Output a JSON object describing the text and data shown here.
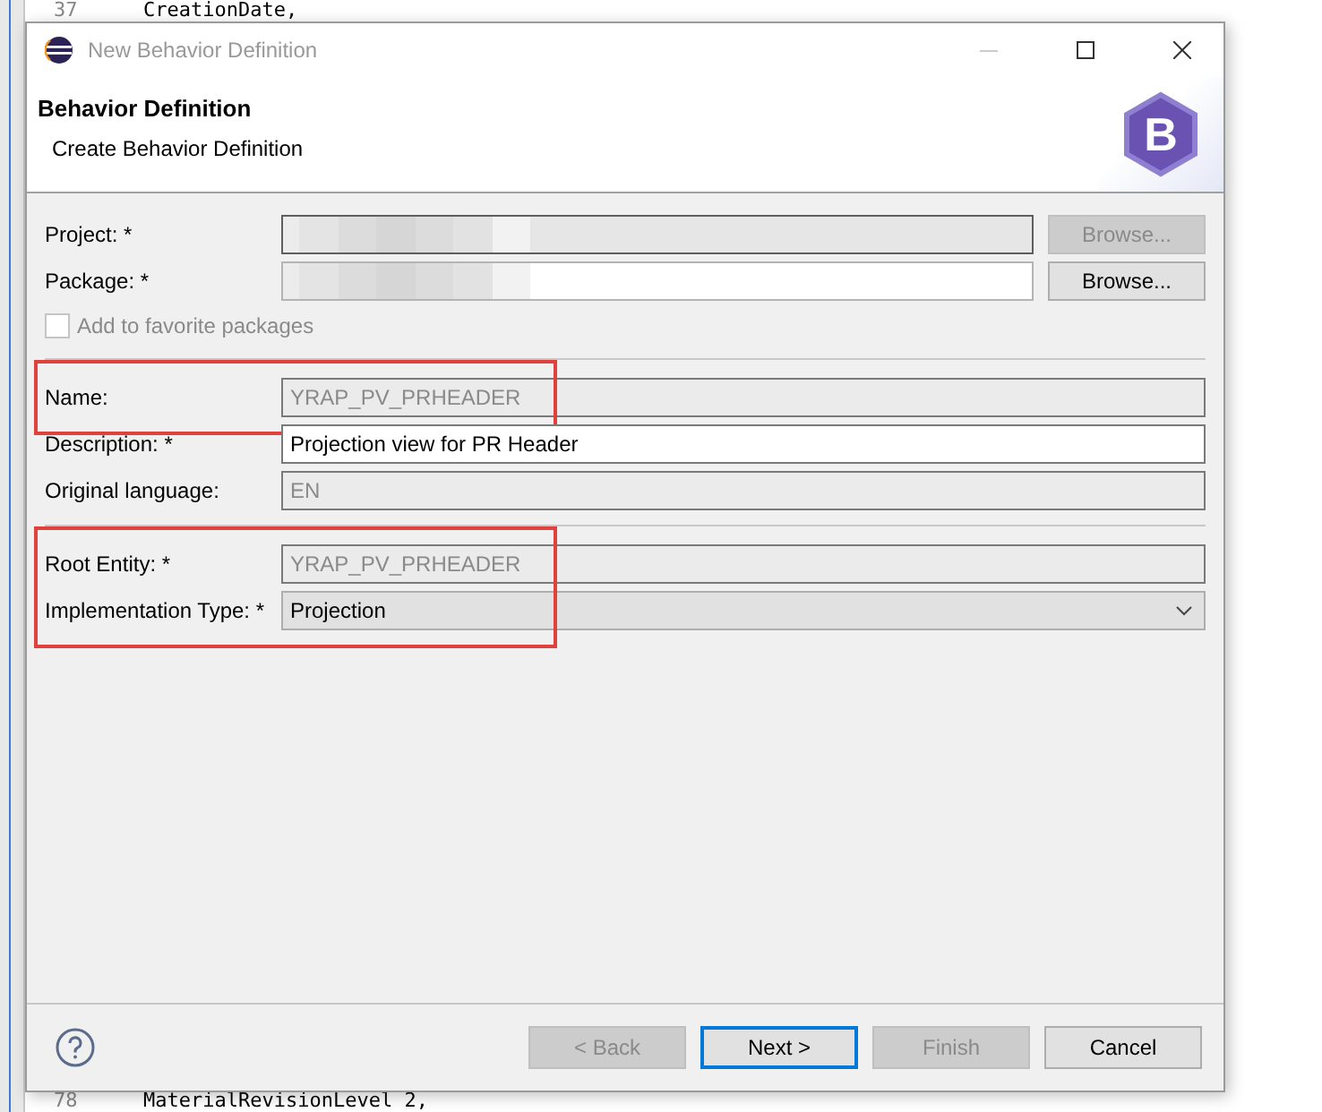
{
  "editor": {
    "top_line": {
      "number": "37",
      "code": "CreationDate,"
    },
    "bottom_line": {
      "number": "78",
      "code": "MaterialRevisionLevel 2,"
    }
  },
  "window": {
    "title": "New Behavior Definition"
  },
  "header": {
    "title": "Behavior Definition",
    "subtitle": "Create Behavior Definition",
    "logo_letter": "B"
  },
  "sections": [
    {
      "rows": [
        {
          "kind": "browse",
          "label": "Project: *",
          "disabled": true,
          "redacted": true,
          "highlighted": false,
          "button": {
            "label": "Browse...",
            "disabled": true
          }
        },
        {
          "kind": "browse",
          "label": "Package: *",
          "disabled": false,
          "redacted": true,
          "highlighted": false,
          "button": {
            "label": "Browse...",
            "disabled": false
          }
        },
        {
          "kind": "checkbox",
          "label": "Add to favorite packages",
          "checked": false,
          "disabled": true,
          "highlighted": false
        }
      ]
    },
    {
      "rows": [
        {
          "kind": "text",
          "label": "Name:",
          "value": "YRAP_PV_PRHEADER",
          "disabled": true,
          "highlighted": true
        },
        {
          "kind": "text",
          "label": "Description: *",
          "value": "Projection view for PR Header",
          "disabled": false,
          "highlighted": false
        },
        {
          "kind": "text",
          "label": "Original language:",
          "value": "EN",
          "disabled": true,
          "highlighted": false
        }
      ]
    },
    {
      "rows": [
        {
          "kind": "text",
          "label": "Root Entity: *",
          "value": "YRAP_PV_PRHEADER",
          "disabled": true,
          "highlighted": true
        },
        {
          "kind": "dropdown",
          "label": "Implementation Type: *",
          "value": "Projection",
          "disabled": false,
          "highlighted": true
        }
      ]
    }
  ],
  "buttons": [
    {
      "label": "< Back",
      "disabled": true,
      "default": false
    },
    {
      "label": "Next >",
      "disabled": false,
      "default": true
    },
    {
      "label": "Finish",
      "disabled": true,
      "default": false
    },
    {
      "label": "Cancel",
      "disabled": false,
      "default": false
    }
  ]
}
